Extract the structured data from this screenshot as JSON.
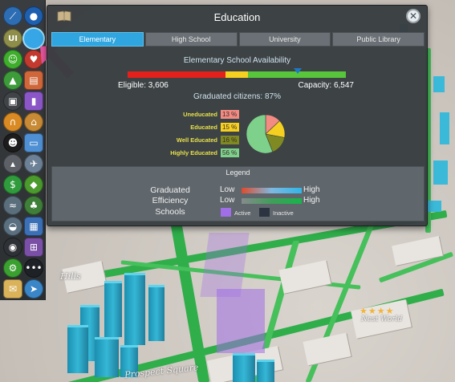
{
  "panel": {
    "title": "Education",
    "close_label": "✕",
    "tabs": [
      {
        "label": "Elementary",
        "active": true
      },
      {
        "label": "High School",
        "active": false
      },
      {
        "label": "University",
        "active": false
      },
      {
        "label": "Public Library",
        "active": false
      }
    ],
    "availability": {
      "title": "Elementary School Availability",
      "eligible_label": "Eligible: 3,606",
      "capacity_label": "Capacity: 6,547",
      "eligible": 3606,
      "capacity": 6547
    },
    "graduated_label": "Graduated citizens: 87%",
    "education_levels": [
      {
        "label": "Uneducated",
        "pct_label": "13 %",
        "value": 13,
        "color": "#f28b82"
      },
      {
        "label": "Educated",
        "pct_label": "15 %",
        "value": 15,
        "color": "#f5d020"
      },
      {
        "label": "Well Educated",
        "pct_label": "16 %",
        "value": 16,
        "color": "#7f8a22"
      },
      {
        "label": "Highly Educated",
        "pct_label": "56 %",
        "value": 56,
        "color": "#7ed18a"
      }
    ],
    "legend": {
      "title": "Legend",
      "graduated": "Graduated",
      "efficiency": "Efficiency",
      "schools": "Schools",
      "low": "Low",
      "high": "High",
      "low2": "Low",
      "high2": "High",
      "active": "Active",
      "inactive": "Inactive"
    }
  },
  "map": {
    "labels": [
      "Prospect Square",
      "Hills",
      "Nest World"
    ],
    "rating_stars": "★★★★"
  },
  "colors": {
    "accent": "#2fa6e0",
    "road": "#2fae4a",
    "buildings": "#35b7d6",
    "highlight": "#a06ee6",
    "arrow": "#e8559e"
  },
  "toolbar": {
    "icons": [
      "road-icon",
      "water-icon",
      "electricity-icon",
      "ui-toggle-icon",
      "education-icon",
      "happy-icon",
      "health-icon",
      "park-icon",
      "zoning-icon",
      "police-icon",
      "garbage-icon",
      "headphones-icon",
      "fire-icon",
      "crime-icon",
      "transport-icon",
      "pollution-icon",
      "tourism-icon",
      "money-icon",
      "landvalue-icon",
      "wind-icon",
      "nature-icon",
      "water-level-icon",
      "city-info-icon",
      "camera-icon",
      "districts-icon",
      "settings-icon",
      "chat-icon",
      "mail-icon",
      "fish-icon"
    ]
  }
}
